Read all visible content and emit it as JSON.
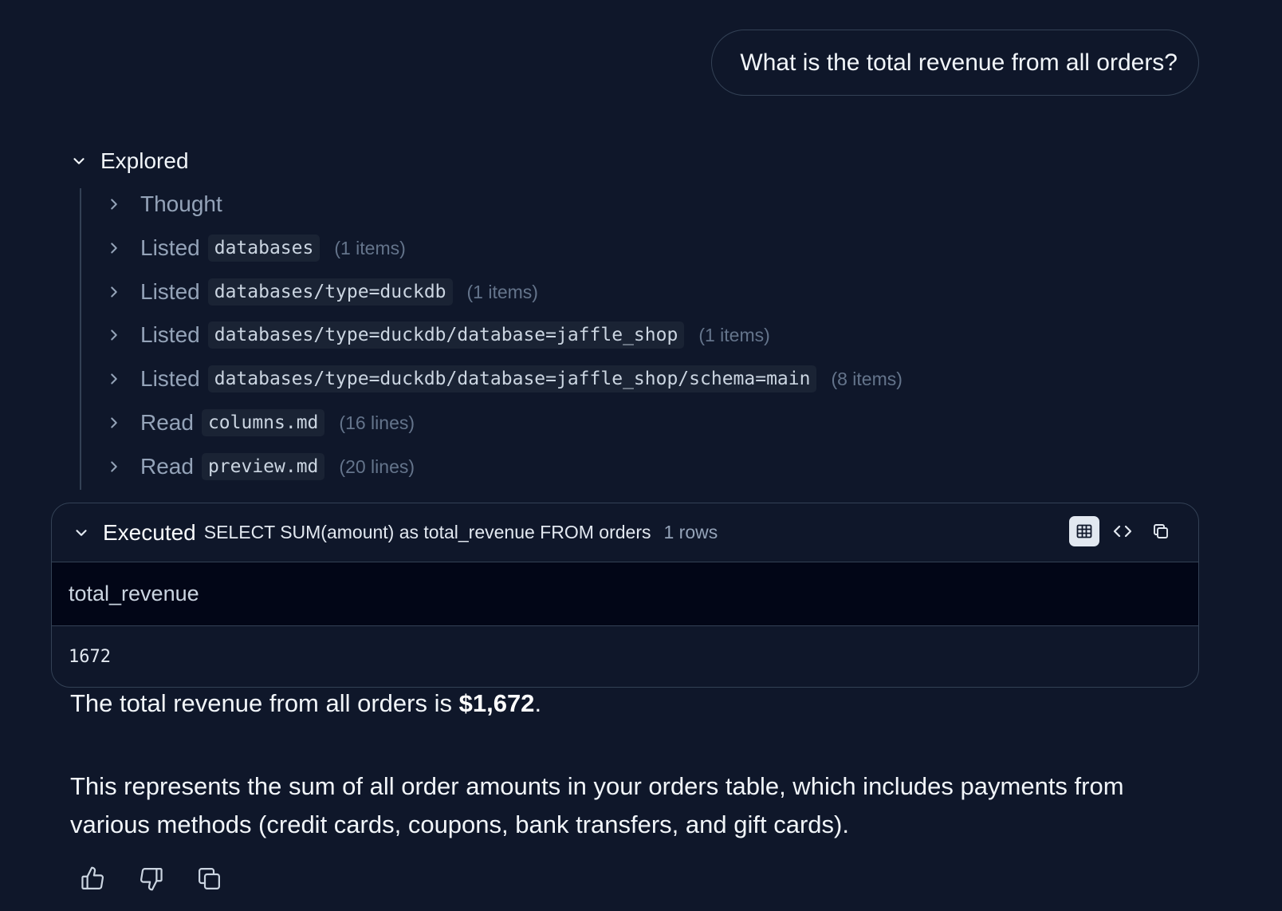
{
  "user_message": "What is the total revenue from all orders?",
  "explored": {
    "label": "Explored",
    "steps": [
      {
        "verb": "Thought"
      },
      {
        "verb": "Listed",
        "path": "databases",
        "count": "(1 items)"
      },
      {
        "verb": "Listed",
        "path": "databases/type=duckdb",
        "count": "(1 items)"
      },
      {
        "verb": "Listed",
        "path": "databases/type=duckdb/database=jaffle_shop",
        "count": "(1 items)"
      },
      {
        "verb": "Listed",
        "path": "databases/type=duckdb/database=jaffle_shop/schema=main",
        "count": "(8 items)"
      },
      {
        "verb": "Read",
        "path": "columns.md",
        "count": "(16 lines)"
      },
      {
        "verb": "Read",
        "path": "preview.md",
        "count": "(20 lines)"
      }
    ]
  },
  "executed": {
    "label": "Executed",
    "sql": "SELECT SUM(amount) as total_revenue FROM orders",
    "rows": "1 rows",
    "column": "total_revenue",
    "value": "1672"
  },
  "answer": {
    "line1_prefix": "The total revenue from all orders is ",
    "line1_bold": "$1,672",
    "line1_suffix": ".",
    "paragraph2": "This represents the sum of all order amounts in your orders table, which includes payments from various methods (credit cards, coupons, bank transfers, and gift cards)."
  },
  "icons": {
    "table_view": "table-icon",
    "code_view": "code-icon",
    "copy": "copy-icon",
    "like": "thumbs-up-icon",
    "dislike": "thumbs-down-icon"
  }
}
